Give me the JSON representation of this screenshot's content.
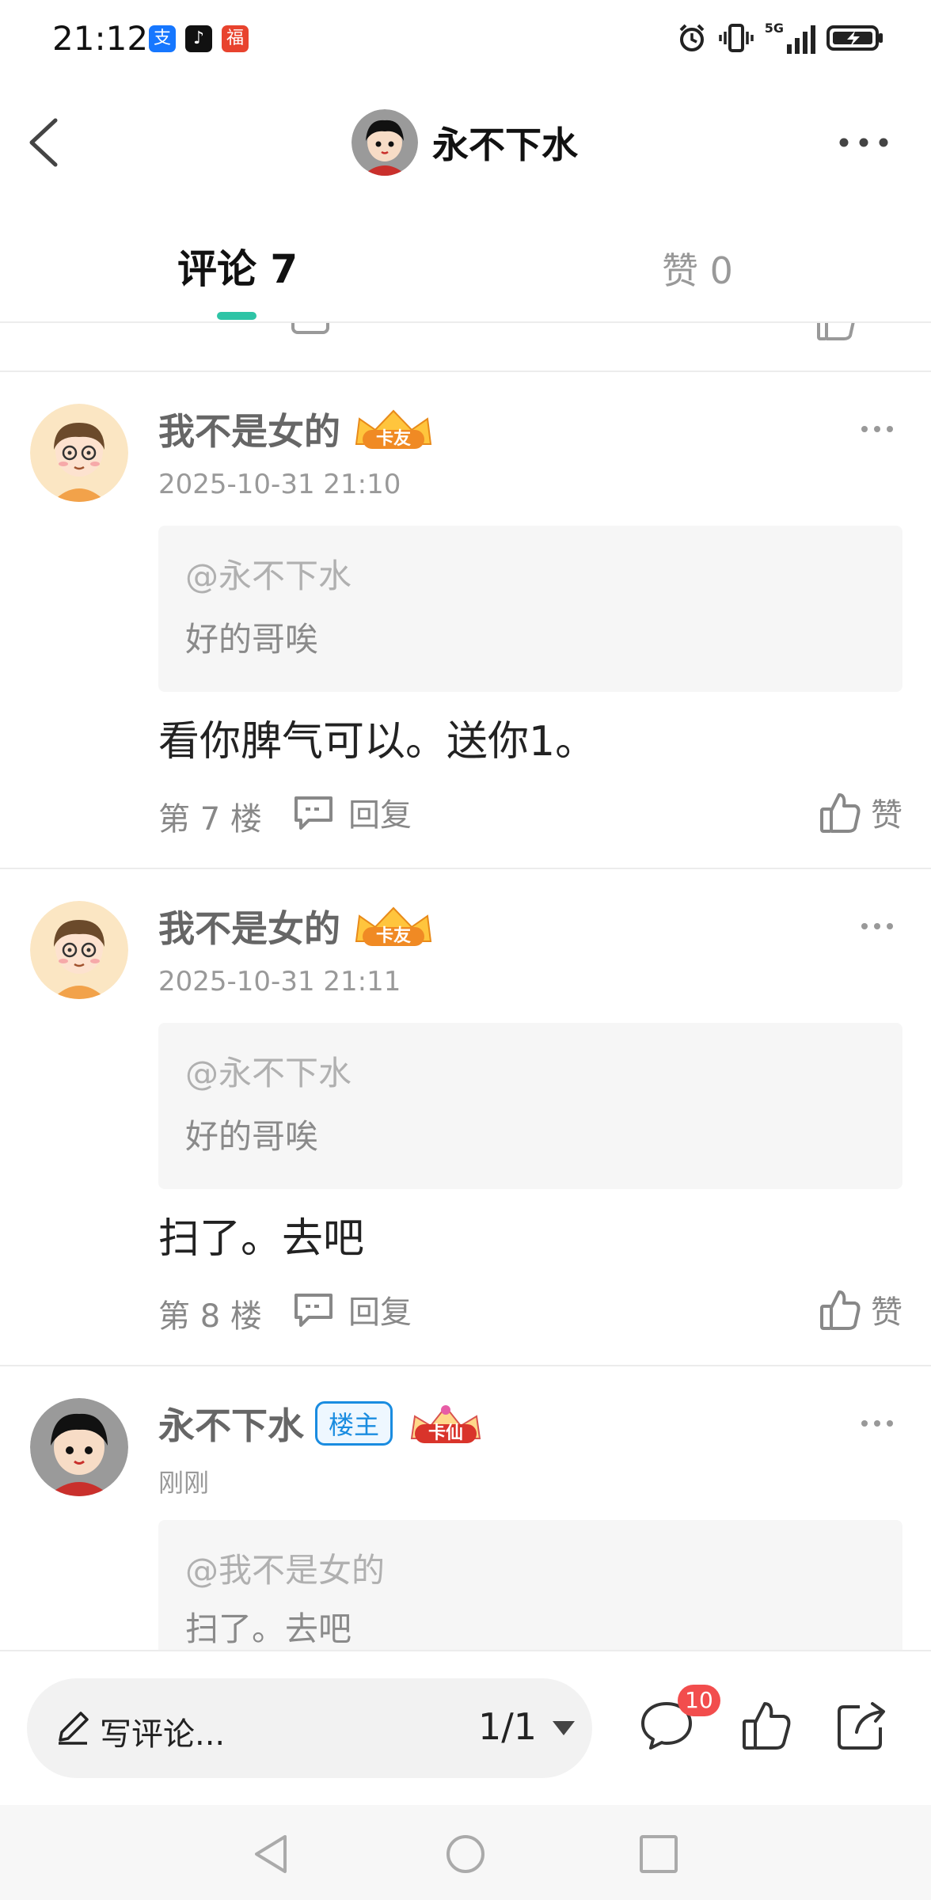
{
  "status_bar": {
    "time": "21:12",
    "icons": [
      "alipay-icon",
      "tiktok-icon",
      "red-envelope-icon"
    ],
    "indicators": [
      "alarm-icon",
      "vibrate-icon",
      "5g-signal-icon",
      "battery-charging-icon"
    ],
    "network_label": "5G"
  },
  "header": {
    "title": "永不下水",
    "back_icon": "chevron-left-icon",
    "more_icon": "more-horizontal-icon"
  },
  "tabs": [
    {
      "label": "评论 7",
      "active": true
    },
    {
      "label": "赞 0",
      "active": false
    }
  ],
  "accent_color": "#2ec4a6",
  "comments": [
    {
      "author": "我不是女的",
      "badge": "卡友",
      "time": "2025-10-31 21:10",
      "quote_at": "@永不下水",
      "quote_text": "好的哥唉",
      "body": "看你脾气可以。送你1。",
      "floor": "第 7 楼",
      "reply": "回复",
      "like": "赞"
    },
    {
      "author": "我不是女的",
      "badge": "卡友",
      "time": "2025-10-31 21:11",
      "quote_at": "@永不下水",
      "quote_text": "好的哥唉",
      "body": "扫了。去吧",
      "floor": "第 8 楼",
      "reply": "回复",
      "like": "赞"
    },
    {
      "author": "永不下水",
      "host_badge": "楼主",
      "badge": "卡仙",
      "time": "刚刚",
      "quote_at": "@我不是女的",
      "quote_text": "扫了。去吧"
    }
  ],
  "bottom_bar": {
    "write_placeholder": "写评论...",
    "page_indicator": "1/1",
    "comment_count": "10"
  }
}
